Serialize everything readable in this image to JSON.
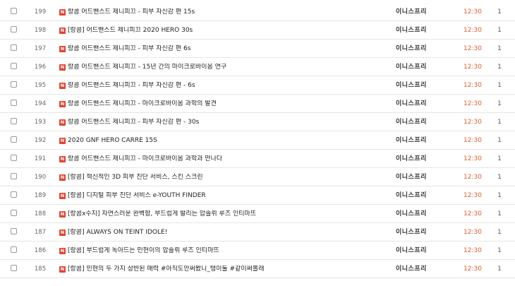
{
  "badge_label": "N",
  "accent_color": "#e04433",
  "time_color": "#e05a2e",
  "rows": [
    {
      "num": "199",
      "title": "랑콤 어드밴스드 제니피끄 - 피부 자신감 편 15s",
      "author": "이니스프리",
      "time": "12:30",
      "views": "1"
    },
    {
      "num": "198",
      "title": "[랑콤] 어드밴스드 제니피끄 2020 HERO 30s",
      "author": "이니스프리",
      "time": "12:30",
      "views": "1"
    },
    {
      "num": "197",
      "title": "랑콤 어드밴스드 제니피끄 - 피부 자신감 편 6s",
      "author": "이니스프리",
      "time": "12:30",
      "views": "1"
    },
    {
      "num": "196",
      "title": "랑콤 어드밴스드 제니피끄 - 15년 간의 마이크로바이옴 연구",
      "author": "이니스프리",
      "time": "12:30",
      "views": "1"
    },
    {
      "num": "195",
      "title": "랑콤 어드밴스드 제니피끄 - 피부 자신감 편 - 6s",
      "author": "이니스프리",
      "time": "12:30",
      "views": "1"
    },
    {
      "num": "194",
      "title": "랑콤 어드밴스드 제니피끄 - 마이크로바이옴 과학의 발견",
      "author": "이니스프리",
      "time": "12:30",
      "views": "1"
    },
    {
      "num": "193",
      "title": "랑콤 어드밴스드 제니피끄 - 피부 자신감 편 - 30s",
      "author": "이니스프리",
      "time": "12:30",
      "views": "1"
    },
    {
      "num": "192",
      "title": "2020 GNF HERO CARRE 15S",
      "author": "이니스프리",
      "time": "12:30",
      "views": "1"
    },
    {
      "num": "191",
      "title": "랑콤 어드밴스드 제니피끄 - 마이크로바이옴 과학과 만나다",
      "author": "이니스프리",
      "time": "12:30",
      "views": "1"
    },
    {
      "num": "190",
      "title": "[랑콤] 혁신적인 3D 피부 진단 서비스, 스킨 스크린",
      "author": "이니스프리",
      "time": "12:30",
      "views": "1"
    },
    {
      "num": "189",
      "title": "[랑콤] 디지털 피부 진단 서비스 e-YOUTH FINDER",
      "author": "이니스프리",
      "time": "12:30",
      "views": "1"
    },
    {
      "num": "188",
      "title": "[랑콤x수지] 자연스러운 완벽함, 부드럽게 발리는 압솔뤼 루즈 인티마뜨",
      "author": "이니스프리",
      "time": "12:30",
      "views": "1"
    },
    {
      "num": "187",
      "title": "[랑콤] ALWAYS ON TEINT IDOLE!",
      "author": "이니스프리",
      "time": "12:30",
      "views": "1"
    },
    {
      "num": "186",
      "title": "[랑콤] 부드럽게 녹아드는 민현이의 압솔뤼 루즈 인티마뜨",
      "author": "이니스프리",
      "time": "12:30",
      "views": "1"
    },
    {
      "num": "185",
      "title": "[랑콤] 민현의 두 가지 상반된 매력 #아직도안써봤니_탱이툴 #같이써볼래",
      "author": "이니스프리",
      "time": "12:30",
      "views": "1"
    }
  ]
}
